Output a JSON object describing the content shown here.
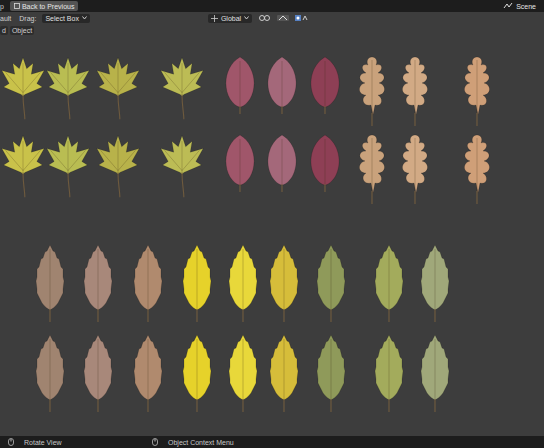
{
  "header": {
    "cut_left": "p",
    "back_button": "Back to Previous",
    "scene": "Scene"
  },
  "tool_header": {
    "mode": "ault",
    "drag_label": "Drag:",
    "drag_value": "Select Box",
    "orientation": "Global"
  },
  "toolbar": {
    "items": [
      "d",
      "Object"
    ]
  },
  "leaves": {
    "rows": [
      {
        "leaves": [
          {
            "kind": "maple",
            "color": "#c9c24a"
          },
          {
            "kind": "maple",
            "color": "#b9bd52"
          },
          {
            "kind": "maple",
            "color": "#b8b24a"
          },
          {
            "kind": "maple",
            "color": "#bcbc55"
          },
          {
            "kind": "round",
            "color": "#a0566a"
          },
          {
            "kind": "round",
            "color": "#a4687a"
          },
          {
            "kind": "round",
            "color": "#8e3f55"
          },
          {
            "kind": "oak",
            "color": "#c9a27c"
          },
          {
            "kind": "oak",
            "color": "#d2aa85"
          },
          {
            "kind": "oak",
            "color": "#cf9f78"
          }
        ]
      },
      {
        "leaves": [
          {
            "kind": "maple",
            "color": "#c9c24a"
          },
          {
            "kind": "maple",
            "color": "#b9bd52"
          },
          {
            "kind": "maple",
            "color": "#b8b24a"
          },
          {
            "kind": "maple",
            "color": "#bcbc55"
          },
          {
            "kind": "round",
            "color": "#a0566a"
          },
          {
            "kind": "round",
            "color": "#a4687a"
          },
          {
            "kind": "round",
            "color": "#8e3f55"
          },
          {
            "kind": "oak",
            "color": "#c9a27c"
          },
          {
            "kind": "oak",
            "color": "#d2aa85"
          },
          {
            "kind": "oak",
            "color": "#cf9f78"
          }
        ]
      },
      {
        "leaves": [
          {
            "kind": "elm",
            "color": "#a08470"
          },
          {
            "kind": "elm",
            "color": "#a8887a"
          },
          {
            "kind": "elm",
            "color": "#b08a6e"
          },
          {
            "kind": "elm",
            "color": "#e6d22a"
          },
          {
            "kind": "elm",
            "color": "#e8d83a"
          },
          {
            "kind": "elm",
            "color": "#d6bd3a"
          },
          {
            "kind": "elm",
            "color": "#8f9a5a"
          },
          {
            "kind": "elm",
            "color": "#a3ab5c"
          },
          {
            "kind": "elm",
            "color": "#a0a87a"
          }
        ]
      },
      {
        "leaves": [
          {
            "kind": "elm",
            "color": "#a08470"
          },
          {
            "kind": "elm",
            "color": "#a8887a"
          },
          {
            "kind": "elm",
            "color": "#b08a6e"
          },
          {
            "kind": "elm",
            "color": "#e6d22a"
          },
          {
            "kind": "elm",
            "color": "#e8d83a"
          },
          {
            "kind": "elm",
            "color": "#d6bd3a"
          },
          {
            "kind": "elm",
            "color": "#8f9a5a"
          },
          {
            "kind": "elm",
            "color": "#a3ab5c"
          },
          {
            "kind": "elm",
            "color": "#a0a87a"
          }
        ]
      }
    ]
  },
  "status_bar": [
    {
      "label": "Rotate View"
    },
    {
      "label": "Object Context Menu"
    }
  ]
}
